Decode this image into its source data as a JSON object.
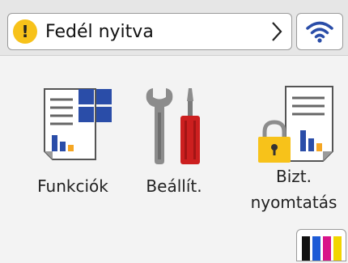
{
  "status": {
    "message": "Fedél nyitva",
    "warning_symbol": "!",
    "icons": [
      "warning-icon",
      "chevron-right-icon",
      "wifi-icon"
    ]
  },
  "menu": {
    "items": [
      {
        "label": "Funkciók",
        "icon": "functions-icon"
      },
      {
        "label": "Beállít.",
        "icon": "settings-tools-icon"
      },
      {
        "label_line1": "Bizt.",
        "label_line2": "nyomtatás",
        "icon": "secure-print-icon"
      }
    ]
  },
  "ink": {
    "icon": "ink-levels-icon",
    "colors": [
      "#111111",
      "#1e5bd6",
      "#d8148a",
      "#f2d500"
    ]
  },
  "colors": {
    "accent_blue": "#2a4da8",
    "warning_yellow": "#f7c21a",
    "tool_red": "#cc1f1f"
  }
}
